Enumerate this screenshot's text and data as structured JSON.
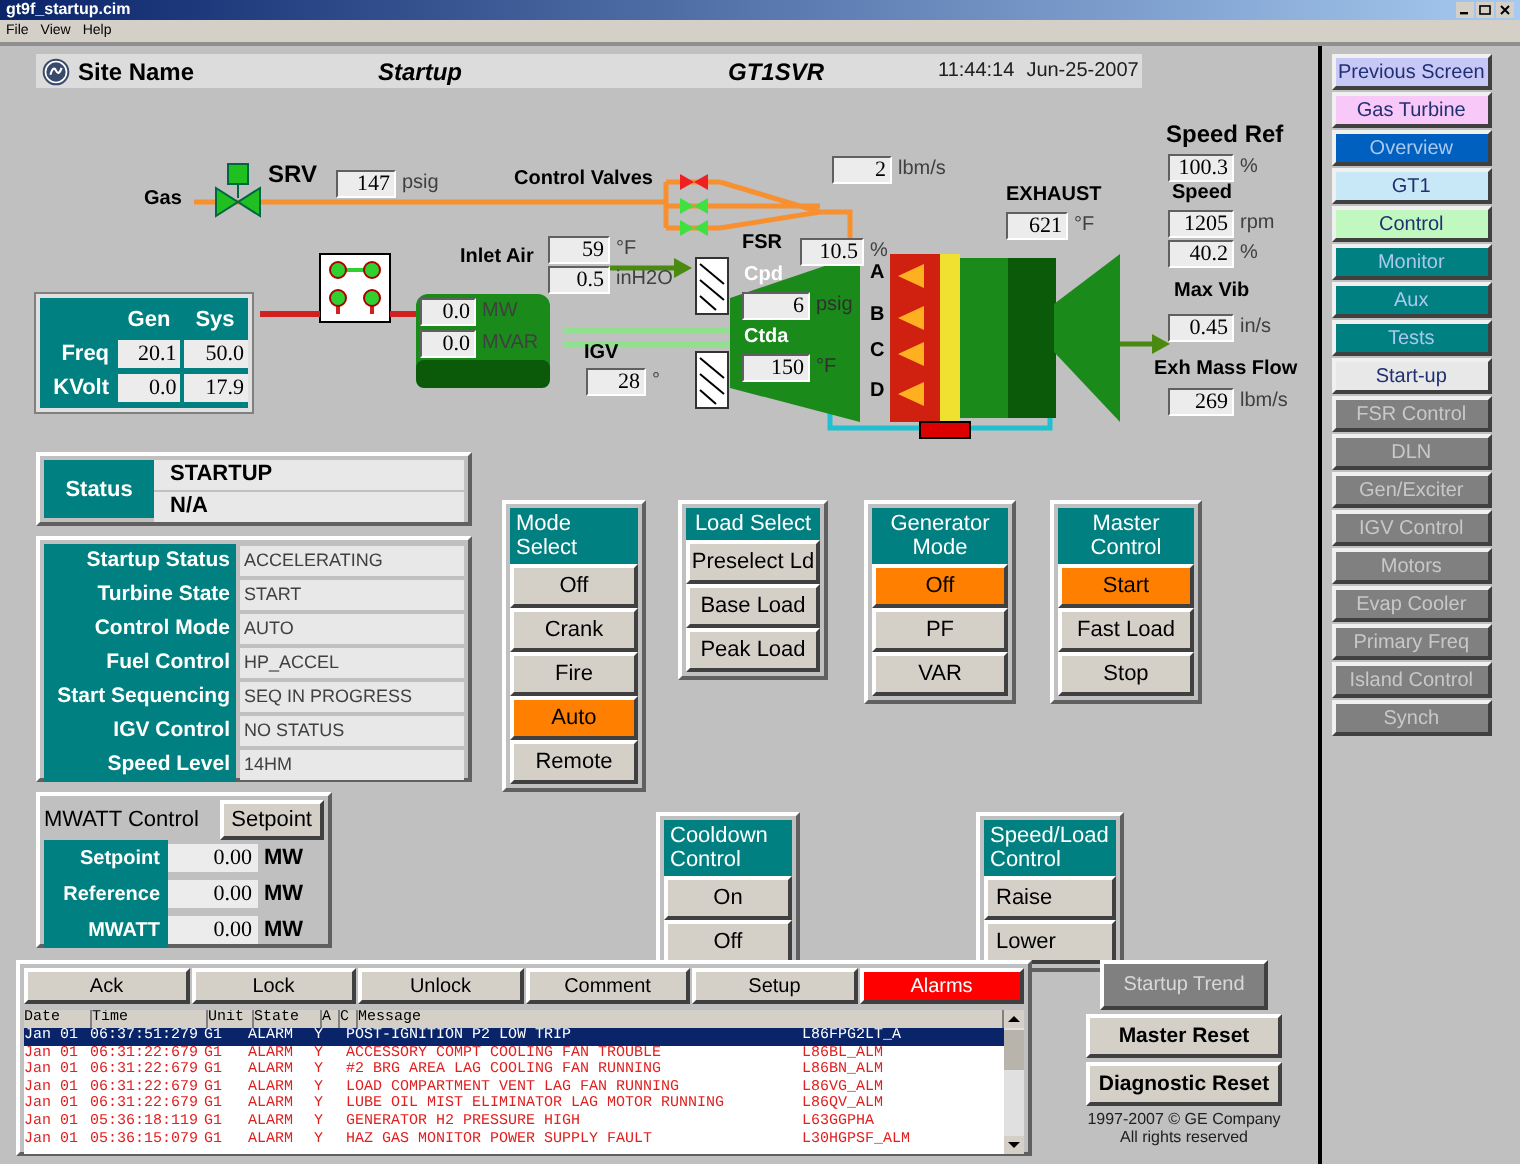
{
  "window": {
    "title": "gt9f_startup.cim"
  },
  "menu": [
    "File",
    "View",
    "Help"
  ],
  "header": {
    "site": "Site Name",
    "screen": "Startup",
    "unit": "GT1SVR",
    "time": "11:44:14",
    "date": "Jun-25-2007"
  },
  "diagram": {
    "gas_label": "Gas",
    "srv": {
      "label": "SRV",
      "open": true
    },
    "gas_pressure": {
      "value": "147",
      "unit": "psig"
    },
    "control_valves": {
      "label": "Control Valves",
      "valves": [
        {
          "open": false
        },
        {
          "open": true
        },
        {
          "open": true
        }
      ]
    },
    "fuel_flow": {
      "value": "2",
      "unit": "lbm/s"
    },
    "inlet_air": {
      "label": "Inlet Air",
      "temperature": {
        "value": "59",
        "unit": "°F"
      },
      "pressure": {
        "value": "0.5",
        "unit": "inH2O"
      }
    },
    "generator": {
      "mw": {
        "value": "0.0",
        "unit": "MW"
      },
      "mvar": {
        "value": "0.0",
        "unit": "MVAR"
      }
    },
    "igv": {
      "label": "IGV",
      "value": "28",
      "unit": "°"
    },
    "fsr": {
      "label": "FSR",
      "value": "10.5",
      "unit": "%"
    },
    "cpd": {
      "label": "Cpd",
      "value": "6",
      "unit": "psig"
    },
    "ctda": {
      "label": "Ctda",
      "value": "150",
      "unit": "°F"
    },
    "combustor_cans": [
      "A",
      "B",
      "C",
      "D"
    ],
    "exhaust": {
      "label": "EXHAUST",
      "value": "621",
      "unit": "°F"
    },
    "speed_ref": {
      "label": "Speed Ref",
      "value": "100.3",
      "unit": "%"
    },
    "speed": {
      "label": "Speed",
      "rpm": {
        "value": "1205",
        "unit": "rpm"
      },
      "percent": {
        "value": "40.2",
        "unit": "%"
      }
    },
    "max_vib": {
      "label": "Max Vib",
      "value": "0.45",
      "unit": "in/s"
    },
    "exh_mass_flow": {
      "label": "Exh Mass Flow",
      "value": "269",
      "unit": "lbm/s"
    },
    "gen_sys": {
      "columns": [
        "Gen",
        "Sys"
      ],
      "rows": [
        {
          "label": "Freq",
          "values": [
            "20.1",
            "50.0"
          ]
        },
        {
          "label": "KVolt",
          "values": [
            "0.0",
            "17.9"
          ]
        }
      ]
    }
  },
  "status": {
    "label": "Status",
    "values": [
      "STARTUP",
      "N/A"
    ]
  },
  "info": [
    {
      "label": "Startup Status",
      "value": "ACCELERATING"
    },
    {
      "label": "Turbine State",
      "value": "START"
    },
    {
      "label": "Control Mode",
      "value": "AUTO"
    },
    {
      "label": "Fuel Control",
      "value": "HP_ACCEL"
    },
    {
      "label": "Start Sequencing",
      "value": "SEQ IN PROGRESS"
    },
    {
      "label": "IGV Control",
      "value": "NO STATUS"
    },
    {
      "label": "Speed Level",
      "value": "14HM"
    }
  ],
  "mwatt": {
    "title": "MWATT Control",
    "button": "Setpoint",
    "rows": [
      {
        "label": "Setpoint",
        "value": "0.00",
        "unit": "MW"
      },
      {
        "label": "Reference",
        "value": "0.00",
        "unit": "MW"
      },
      {
        "label": "MWATT",
        "value": "0.00",
        "unit": "MW"
      }
    ]
  },
  "control_groups": [
    {
      "title": "Mode Select",
      "buttons": [
        {
          "label": "Off",
          "selected": false
        },
        {
          "label": "Crank",
          "selected": false
        },
        {
          "label": "Fire",
          "selected": false
        },
        {
          "label": "Auto",
          "selected": true
        },
        {
          "label": "Remote",
          "selected": false
        }
      ]
    },
    {
      "title": "Load Select",
      "buttons": [
        {
          "label": "Preselect Ld",
          "selected": false
        },
        {
          "label": "Base Load",
          "selected": false
        },
        {
          "label": "Peak Load",
          "selected": false
        }
      ]
    },
    {
      "title": "Generator Mode",
      "buttons": [
        {
          "label": "Off",
          "selected": true
        },
        {
          "label": "PF",
          "selected": false
        },
        {
          "label": "VAR",
          "selected": false
        }
      ]
    },
    {
      "title": "Master Control",
      "buttons": [
        {
          "label": "Start",
          "selected": true
        },
        {
          "label": "Fast Load",
          "selected": false
        },
        {
          "label": "Stop",
          "selected": false
        }
      ]
    }
  ],
  "lower_groups": [
    {
      "title": "Cooldown Control",
      "buttons": [
        {
          "label": "On",
          "selected": false
        },
        {
          "label": "Off",
          "selected": false
        }
      ]
    },
    {
      "title": "Speed/Load Control",
      "buttons": [
        {
          "label": "Raise",
          "selected": false
        },
        {
          "label": "Lower",
          "selected": false
        }
      ]
    }
  ],
  "alarm_toolbar": [
    {
      "label": "Ack",
      "selected": false
    },
    {
      "label": "Lock",
      "selected": false
    },
    {
      "label": "Unlock",
      "selected": false
    },
    {
      "label": "Comment",
      "selected": false
    },
    {
      "label": "Setup",
      "selected": false
    },
    {
      "label": "Alarms",
      "selected": true
    }
  ],
  "alarm_table": {
    "columns": [
      "Date",
      "Time",
      "Unit",
      "State",
      "A",
      "C",
      "Message"
    ],
    "rows": [
      {
        "date": "Jan 01",
        "time": "06:37:51:279",
        "unit": "G1",
        "state": "ALARM",
        "a": "Y",
        "message": "POST-IGNITION P2 LOW TRIP",
        "signal": "L86FPG2LT_A",
        "selected": true
      },
      {
        "date": "Jan 01",
        "time": "06:31:22:679",
        "unit": "G1",
        "state": "ALARM",
        "a": "Y",
        "message": "ACCESSORY COMPT COOLING FAN TROUBLE",
        "signal": "L86BL_ALM",
        "selected": false
      },
      {
        "date": "Jan 01",
        "time": "06:31:22:679",
        "unit": "G1",
        "state": "ALARM",
        "a": "Y",
        "message": "#2 BRG AREA LAG COOLING FAN RUNNING",
        "signal": "L86BN_ALM",
        "selected": false
      },
      {
        "date": "Jan 01",
        "time": "06:31:22:679",
        "unit": "G1",
        "state": "ALARM",
        "a": "Y",
        "message": "LOAD COMPARTMENT VENT LAG FAN RUNNING",
        "signal": "L86VG_ALM",
        "selected": false
      },
      {
        "date": "Jan 01",
        "time": "06:31:22:679",
        "unit": "G1",
        "state": "ALARM",
        "a": "Y",
        "message": "LUBE OIL MIST ELIMINATOR LAG MOTOR RUNNING",
        "signal": "L86QV_ALM",
        "selected": false
      },
      {
        "date": "Jan 01",
        "time": "05:36:18:119",
        "unit": "G1",
        "state": "ALARM",
        "a": "Y",
        "message": "GENERATOR H2 PRESSURE HIGH",
        "signal": "L63GGPHA",
        "selected": false
      },
      {
        "date": "Jan 01",
        "time": "05:36:15:079",
        "unit": "G1",
        "state": "ALARM",
        "a": "Y",
        "message": "HAZ GAS MONITOR POWER SUPPLY FAULT",
        "signal": "L30HGPSF_ALM",
        "selected": false
      }
    ]
  },
  "side_buttons": [
    {
      "label": "Startup Trend",
      "disabled": true
    },
    {
      "label": "Master Reset",
      "disabled": false
    },
    {
      "label": "Diagnostic Reset",
      "disabled": false
    }
  ],
  "copyright": [
    "1997-2007 © GE Company",
    "All rights reserved"
  ],
  "nav": [
    {
      "label": "Previous Screen",
      "color": "#c8c8f8"
    },
    {
      "label": "Gas Turbine",
      "color": "#f8c8f8"
    },
    {
      "label": "Overview",
      "color": "#0060c0"
    },
    {
      "label": "GT1",
      "color": "#c8e8f8"
    },
    {
      "label": "Control",
      "color": "#c0f8c0"
    },
    {
      "label": "Monitor",
      "color": "#008080"
    },
    {
      "label": "Aux",
      "color": "#008080"
    },
    {
      "label": "Tests",
      "color": "#008080"
    },
    {
      "label": "Start-up",
      "color": "#e8e8e8"
    },
    {
      "label": "FSR Control",
      "color": "#808080"
    },
    {
      "label": "DLN",
      "color": "#808080"
    },
    {
      "label": "Gen/Exciter",
      "color": "#808080"
    },
    {
      "label": "IGV Control",
      "color": "#808080"
    },
    {
      "label": "Motors",
      "color": "#808080"
    },
    {
      "label": "Evap Cooler",
      "color": "#808080"
    },
    {
      "label": "Primary Freq",
      "color": "#808080"
    },
    {
      "label": "Island Control",
      "color": "#808080"
    },
    {
      "label": "Synch",
      "color": "#808080"
    }
  ]
}
